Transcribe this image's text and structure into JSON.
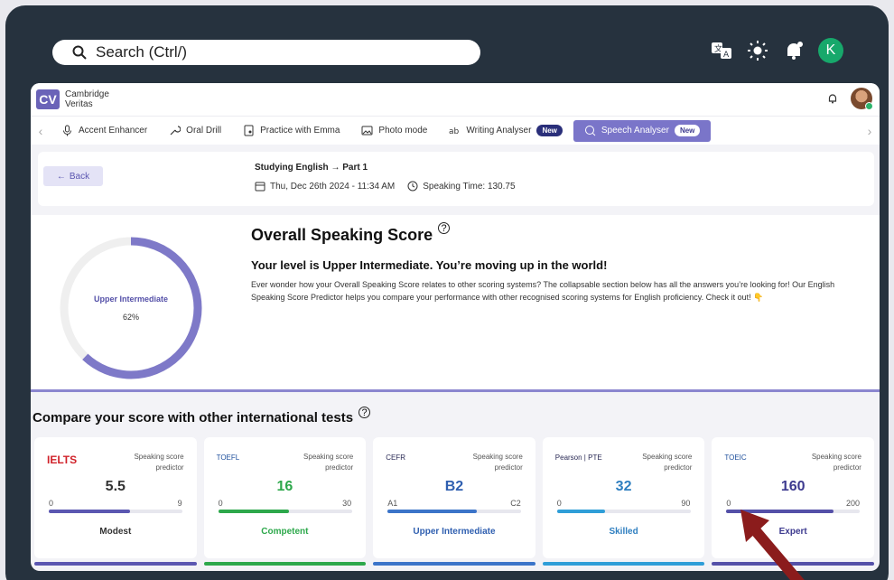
{
  "top_bar": {
    "search_label": "Search (Ctrl/)",
    "avatar_initial": "K"
  },
  "app": {
    "logo_letters": "CV",
    "brand_line1": "Cambridge",
    "brand_line2": "Veritas"
  },
  "tabs": [
    {
      "label": "Accent Enhancer",
      "icon": "mic-icon"
    },
    {
      "label": "Oral Drill",
      "icon": "wrench-icon"
    },
    {
      "label": "Practice with Emma",
      "icon": "doc-person-icon"
    },
    {
      "label": "Photo mode",
      "icon": "photo-icon"
    },
    {
      "label": "Writing Analyser",
      "icon": "writing-icon",
      "badge": "New"
    },
    {
      "label": "Speech Analyser",
      "icon": "speech-icon",
      "badge": "New",
      "active": true
    }
  ],
  "session": {
    "back_label": "Back",
    "breadcrumb_topic": "Studying English",
    "breadcrumb_part": "Part 1",
    "datetime": "Thu, Dec 26th 2024 - 11:34 AM",
    "speaking_time": "Speaking Time: 130.75"
  },
  "overall": {
    "title": "Overall Speaking Score",
    "level_label": "Upper Intermediate",
    "percent": 62,
    "percent_text": "62%",
    "subtitle": "Your level is Upper Intermediate. You’re moving up in the world!",
    "description": "Ever wonder how your Overall Speaking Score relates to other scoring systems? The collapsable section below has all the answers you’re looking for! Our English Speaking Score Predictor helps you compare your performance with other recognised scoring systems for English proficiency. Check it out! 👇"
  },
  "compare": {
    "title": "Compare your score with other international tests",
    "predictor_label": "Speaking score predictor",
    "tests": [
      {
        "name": "IELTS",
        "value": "5.5",
        "min": "0",
        "max": "9",
        "fraction": 0.61,
        "level": "Modest",
        "color": "#5b57b1",
        "level_color": "#333333",
        "logo_color": "#d0222a"
      },
      {
        "name": "TOEFL",
        "value": "16",
        "min": "0",
        "max": "30",
        "fraction": 0.53,
        "level": "Competent",
        "color": "#2da84b",
        "level_color": "#2da84b",
        "logo_color": "#1e4f9c"
      },
      {
        "name": "CEFR",
        "value": "B2",
        "min": "A1",
        "max": "C2",
        "fraction": 0.67,
        "level": "Upper Intermediate",
        "color": "#3b74c9",
        "level_color": "#2f5fb0",
        "logo_color": "#2a2a55"
      },
      {
        "name": "Pearson | PTE",
        "value": "32",
        "min": "0",
        "max": "90",
        "fraction": 0.36,
        "level": "Skilled",
        "color": "#2f9ed8",
        "level_color": "#2f7fc0",
        "logo_color": "#2a2a55"
      },
      {
        "name": "TOEIC",
        "value": "160",
        "min": "0",
        "max": "200",
        "fraction": 0.8,
        "level": "Expert",
        "color": "#5450a8",
        "level_color": "#3d3a8f",
        "logo_color": "#1e4f9c"
      }
    ]
  }
}
